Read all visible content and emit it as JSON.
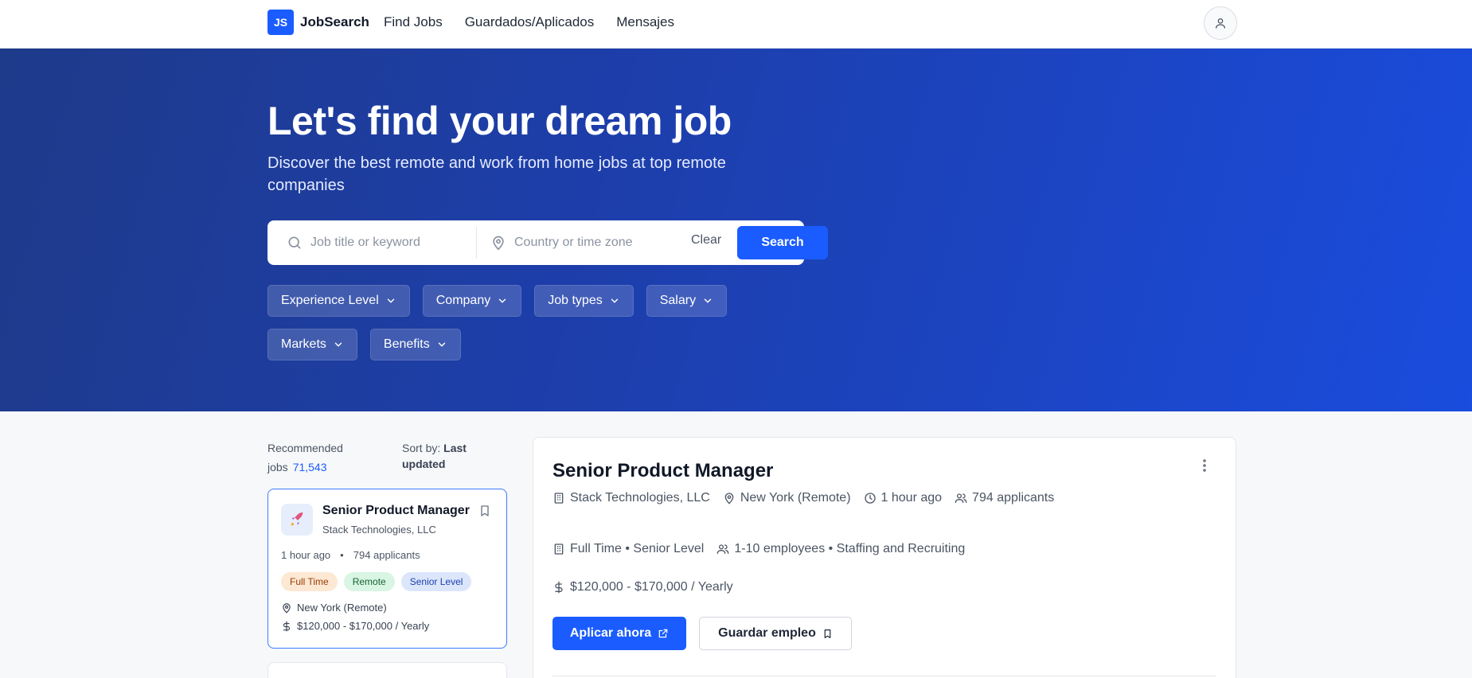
{
  "nav": {
    "logo_badge": "JS",
    "logo_text": "JobSearch",
    "links": [
      "Find Jobs",
      "Guardados/Aplicados",
      "Mensajes"
    ],
    "avatar_icon": "user-icon"
  },
  "hero": {
    "title": "Let's find your dream job",
    "subtitle": "Discover the best remote and work from home jobs at top remote companies",
    "search": {
      "keyword_placeholder": "Job title or keyword",
      "location_placeholder": "Country or time zone",
      "clear_label": "Clear",
      "search_label": "Search"
    },
    "filters": [
      "Experience Level",
      "Company",
      "Job types",
      "Salary",
      "Markets",
      "Benefits"
    ]
  },
  "list": {
    "recommended_label": "Recommended jobs",
    "recommended_count": "71,543",
    "sort_label": "Sort by:",
    "sort_value": "Last updated",
    "jobs": [
      {
        "title": "Senior Product Manager",
        "company": "Stack Technologies, LLC",
        "posted": "1 hour ago",
        "applicants": "794 applicants",
        "tags": [
          "Full Time",
          "Remote",
          "Senior Level"
        ],
        "location": "New York (Remote)",
        "salary": "$120,000 - $170,000 / Yearly"
      }
    ]
  },
  "detail": {
    "title": "Senior Product Manager",
    "company": "Stack Technologies, LLC",
    "location": "New York (Remote)",
    "posted": "1 hour ago",
    "applicants": "794 applicants",
    "job_info": "Full Time • Senior Level",
    "company_info": "1-10 employees • Staffing and Recruiting",
    "salary": "$120,000 - $170,000 / Yearly",
    "apply_label": "Aplicar ahora",
    "save_label": "Guardar empleo"
  },
  "colors": {
    "primary": "#1a5cff",
    "hero_start": "#1e3a8a",
    "hero_end": "#1a4cdd"
  }
}
